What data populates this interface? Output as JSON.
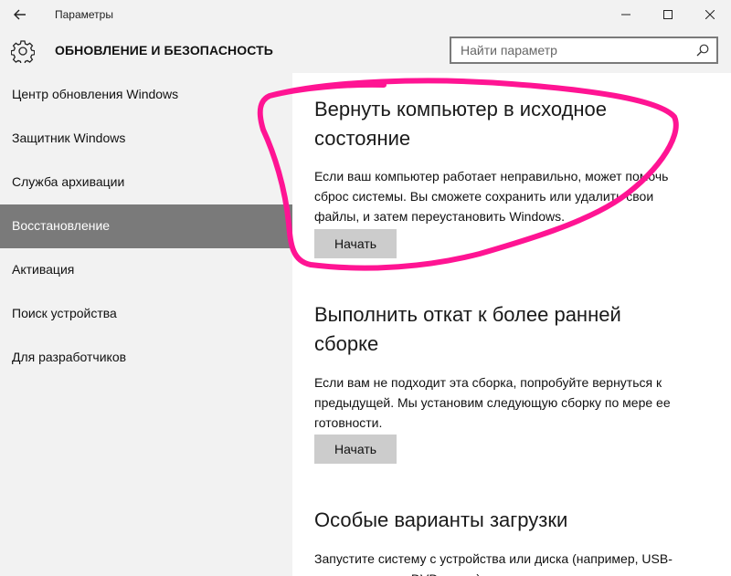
{
  "window": {
    "title": "Параметры",
    "back_icon": "arrow-left-icon",
    "controls": [
      "minimize-icon",
      "maximize-icon",
      "close-icon"
    ]
  },
  "header": {
    "icon": "gear-icon",
    "title": "ОБНОВЛЕНИЕ И БЕЗОПАСНОСТЬ",
    "search_placeholder": "Найти параметр",
    "search_icon": "search-icon"
  },
  "sidebar": {
    "selected_index": 3,
    "selected_color": "#7a7a7a",
    "items": [
      {
        "label": "Центр обновления Windows"
      },
      {
        "label": "Защитник Windows"
      },
      {
        "label": "Служба архивации"
      },
      {
        "label": "Восстановление"
      },
      {
        "label": "Активация"
      },
      {
        "label": "Поиск устройства"
      },
      {
        "label": "Для разработчиков"
      }
    ]
  },
  "main": {
    "sections": [
      {
        "title_line1": "Вернуть компьютер в исходное",
        "title_line2": "состояние",
        "desc_line1": "Если ваш компьютер работает неправильно, может помочь",
        "desc_line2": "сброс системы. Вы сможете сохранить или удалить свои",
        "desc_line3": "файлы, и затем переустановить Windows.",
        "button_label": "Начать"
      },
      {
        "title_line1": "Выполнить откат к более ранней",
        "title_line2": "сборке",
        "desc_line1": "Если вам не подходит эта сборка, попробуйте вернуться к",
        "desc_line2": "предыдущей. Мы установим следующую сборку по мере ее",
        "desc_line3": "готовности.",
        "button_label": "Начать"
      },
      {
        "title_line1": "Особые варианты загрузки",
        "desc_line1": "Запустите систему с устройства или диска (например, USB-",
        "desc_line2": "накопителя или DVD-диска), измените параметры"
      }
    ]
  },
  "annotation": {
    "color": "#ff1493"
  }
}
